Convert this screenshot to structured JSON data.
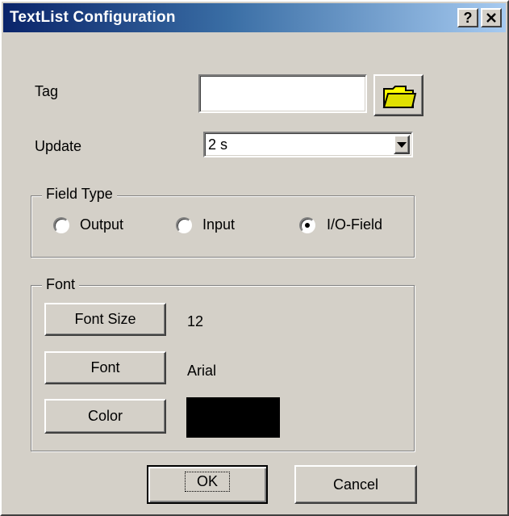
{
  "window": {
    "title": "TextList Configuration"
  },
  "titlebar": {
    "help_label": "?",
    "close_label": "✕"
  },
  "tag": {
    "label": "Tag",
    "value": "",
    "browse_icon": "folder-icon"
  },
  "update": {
    "label": "Update",
    "value": "2 s"
  },
  "field_type": {
    "legend": "Field Type",
    "options": [
      {
        "label": "Output",
        "selected": false
      },
      {
        "label": "Input",
        "selected": false
      },
      {
        "label": "I/O-Field",
        "selected": true
      }
    ]
  },
  "font": {
    "legend": "Font",
    "size_button": "Font Size",
    "size_value": "12",
    "font_button": "Font",
    "font_value": "Arial",
    "color_button": "Color",
    "color_value": "#000000"
  },
  "buttons": {
    "ok": "OK",
    "cancel": "Cancel"
  }
}
